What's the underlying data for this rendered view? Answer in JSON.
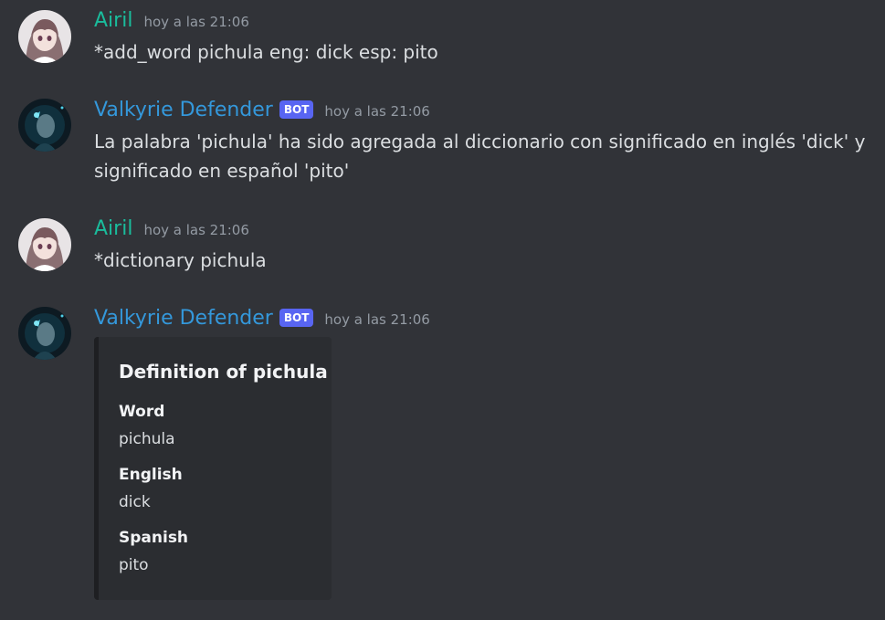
{
  "messages": [
    {
      "author": "Airil",
      "avatar": "anime-girl-avatar",
      "timestamp": "hoy a las 21:06",
      "text": "*add_word pichula eng: dick esp: pito"
    },
    {
      "author": "Valkyrie Defender",
      "badge": "BOT",
      "avatar": "valkyrie-avatar",
      "timestamp": "hoy a las 21:06",
      "text": "La palabra 'pichula' ha sido agregada al diccionario con significado en inglés 'dick' y significado en español 'pito'"
    },
    {
      "author": "Airil",
      "avatar": "anime-girl-avatar",
      "timestamp": "hoy a las 21:06",
      "text": "*dictionary pichula"
    },
    {
      "author": "Valkyrie Defender",
      "badge": "BOT",
      "avatar": "valkyrie-avatar",
      "timestamp": "hoy a las 21:06",
      "embed": {
        "title": "Definition of pichula",
        "fields": [
          {
            "name": "Word",
            "value": "pichula"
          },
          {
            "name": "English",
            "value": "dick"
          },
          {
            "name": "Spanish",
            "value": "pito"
          }
        ]
      }
    }
  ],
  "colors": {
    "background": "#313338",
    "embed_background": "#2b2d31",
    "airil_name": "#1abc9c",
    "bot_name": "#3498db",
    "bot_badge": "#5865f2",
    "timestamp": "#949ba4"
  }
}
